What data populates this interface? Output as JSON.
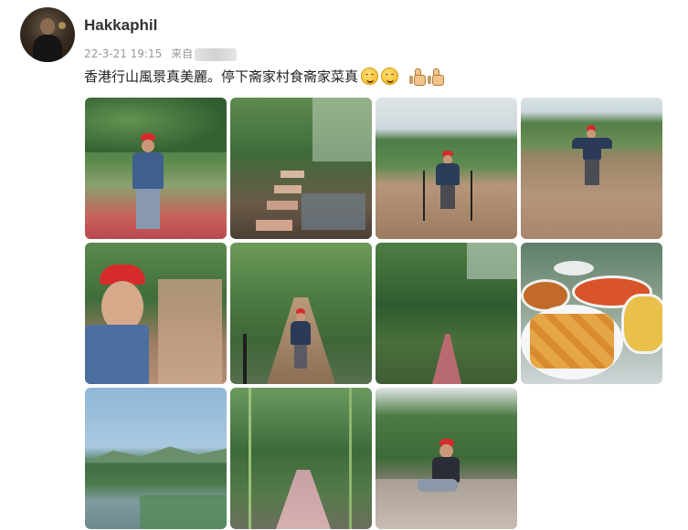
{
  "post": {
    "username": "Hakkaphil",
    "timestamp": "22-3-21 19:15",
    "source_prefix": "来自",
    "text": "香港行山風景真美麗。停下斋家村食斋家菜真",
    "emoji": [
      "grinning-face",
      "grinning-face",
      "thumbs-up",
      "thumbs-up"
    ]
  },
  "photos": [
    {
      "name": "photo-hiker-red-soil"
    },
    {
      "name": "photo-stone-steps-stream"
    },
    {
      "name": "photo-hiker-muddy-flats"
    },
    {
      "name": "photo-hiker-tidal-pool"
    },
    {
      "name": "photo-selfie-trail"
    },
    {
      "name": "photo-boardwalk-forest"
    },
    {
      "name": "photo-jungle-path"
    },
    {
      "name": "photo-vegetarian-dishes"
    },
    {
      "name": "photo-lake-hills"
    },
    {
      "name": "photo-bamboo-path"
    },
    {
      "name": "photo-hiker-sitting-rocks"
    }
  ]
}
